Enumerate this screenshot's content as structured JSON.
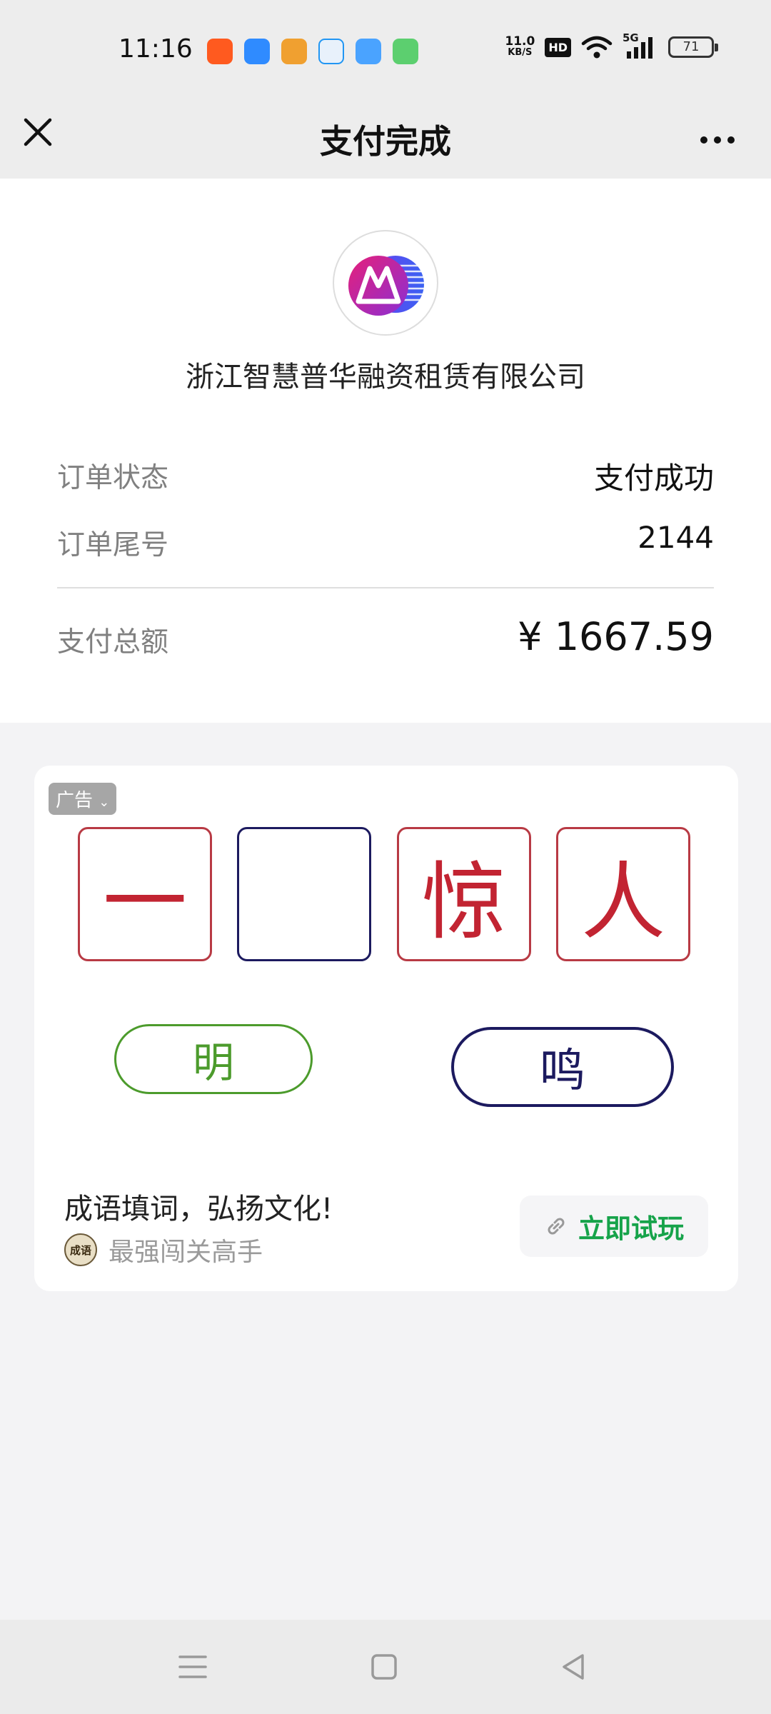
{
  "status_bar": {
    "time": "11:16",
    "network_speed_value": "11.0",
    "network_speed_unit": "KB/S",
    "hd_label": "HD",
    "network_type": "5G",
    "battery_level": "71",
    "app_icons": [
      {
        "name": "taobao-app-icon",
        "color": "#ff5a1f"
      },
      {
        "name": "files-app-icon",
        "color": "#2f8bff"
      },
      {
        "name": "wallet-app-icon",
        "color": "#f0a030"
      },
      {
        "name": "search-app-icon",
        "color": "#2196f3"
      },
      {
        "name": "weather-app-icon",
        "color": "#4aa3ff"
      },
      {
        "name": "store-app-icon",
        "color": "#5ccf6f"
      }
    ]
  },
  "nav": {
    "title": "支付完成"
  },
  "receipt": {
    "merchant_name": "浙江智慧普华融资租赁有限公司",
    "rows": [
      {
        "label": "订单状态",
        "value": "支付成功"
      },
      {
        "label": "订单尾号",
        "value": "2144"
      }
    ],
    "total_label": "支付总额",
    "total_amount": "¥ 1667.59"
  },
  "ad": {
    "badge": "广告",
    "idiom_chars": [
      "一",
      "",
      "惊",
      "人"
    ],
    "options": [
      "明",
      "鸣"
    ],
    "title": "成语填词，弘扬文化!",
    "source_avatar_text": "成语",
    "source_name": "最强闯关高手",
    "cta_label": "立即试玩"
  },
  "colors": {
    "accent_green": "#16a34a",
    "idiom_red": "#c22432",
    "idiom_navy": "#1c1a5f",
    "option_green": "#4c9b2c"
  }
}
